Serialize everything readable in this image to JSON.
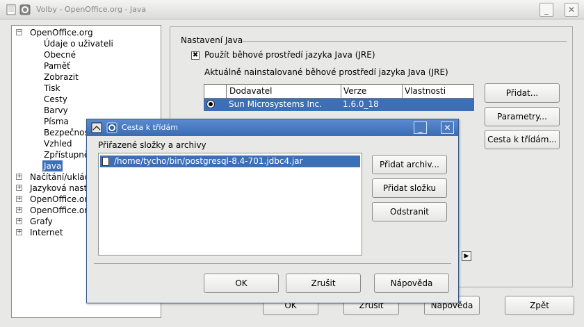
{
  "window": {
    "title": "Volby - OpenOffice.org - Java",
    "minimize": "_",
    "close": "✕",
    "icon": "openoffice-gull-icon"
  },
  "tree": {
    "items": [
      {
        "label": "OpenOffice.org",
        "expander": "−"
      },
      {
        "label": "Údaje o uživateli"
      },
      {
        "label": "Obecné"
      },
      {
        "label": "Paměť"
      },
      {
        "label": "Zobrazit"
      },
      {
        "label": "Tisk"
      },
      {
        "label": "Cesty"
      },
      {
        "label": "Barvy"
      },
      {
        "label": "Písma"
      },
      {
        "label": "Bezpečnost"
      },
      {
        "label": "Vzhled"
      },
      {
        "label": "Zpřístupnění"
      },
      {
        "label": "Java"
      },
      {
        "label": "Načítání/ukládání",
        "expander": "+"
      },
      {
        "label": "Jazyková nastavení",
        "expander": "+"
      },
      {
        "label": "OpenOffice.org Writer",
        "expander": "+"
      },
      {
        "label": "OpenOffice.org Base",
        "expander": "+"
      },
      {
        "label": "Grafy",
        "expander": "+"
      },
      {
        "label": "Internet",
        "expander": "+"
      }
    ]
  },
  "java_panel": {
    "section_title": "Nastavení Java",
    "use_jre_label": "Použít běhové prostředí jazyka Java (JRE)",
    "use_jre_checked": "✖",
    "installed_label": "Aktuálně nainstalované běhové prostředí jazyka Java (JRE)",
    "columns": [
      "Dodavatel",
      "Verze",
      "Vlastnosti"
    ],
    "rows": [
      {
        "vendor": "Sun Microsystems Inc.",
        "version": "1.6.0_18",
        "properties": ""
      }
    ],
    "buttons": {
      "add": "Přidat...",
      "parameters": "Parametry...",
      "classpath": "Cesta k třídám..."
    }
  },
  "footer": {
    "ok": "OK",
    "cancel": "Zrušit",
    "help": "Nápověda",
    "back": "Zpět"
  },
  "dialog": {
    "title": "Cesta k třídám",
    "minimize": "_",
    "close": "✕",
    "list_label": "Přiřazené složky a archivy",
    "entries": [
      "/home/tycho/bin/postgresql-8.4-701.jdbc4.jar"
    ],
    "buttons": {
      "add_archive": "Přidat archiv...",
      "add_folder": "Přidat složku",
      "remove": "Odstranit",
      "ok": "OK",
      "cancel": "Zrušit",
      "help": "Nápověda"
    }
  }
}
